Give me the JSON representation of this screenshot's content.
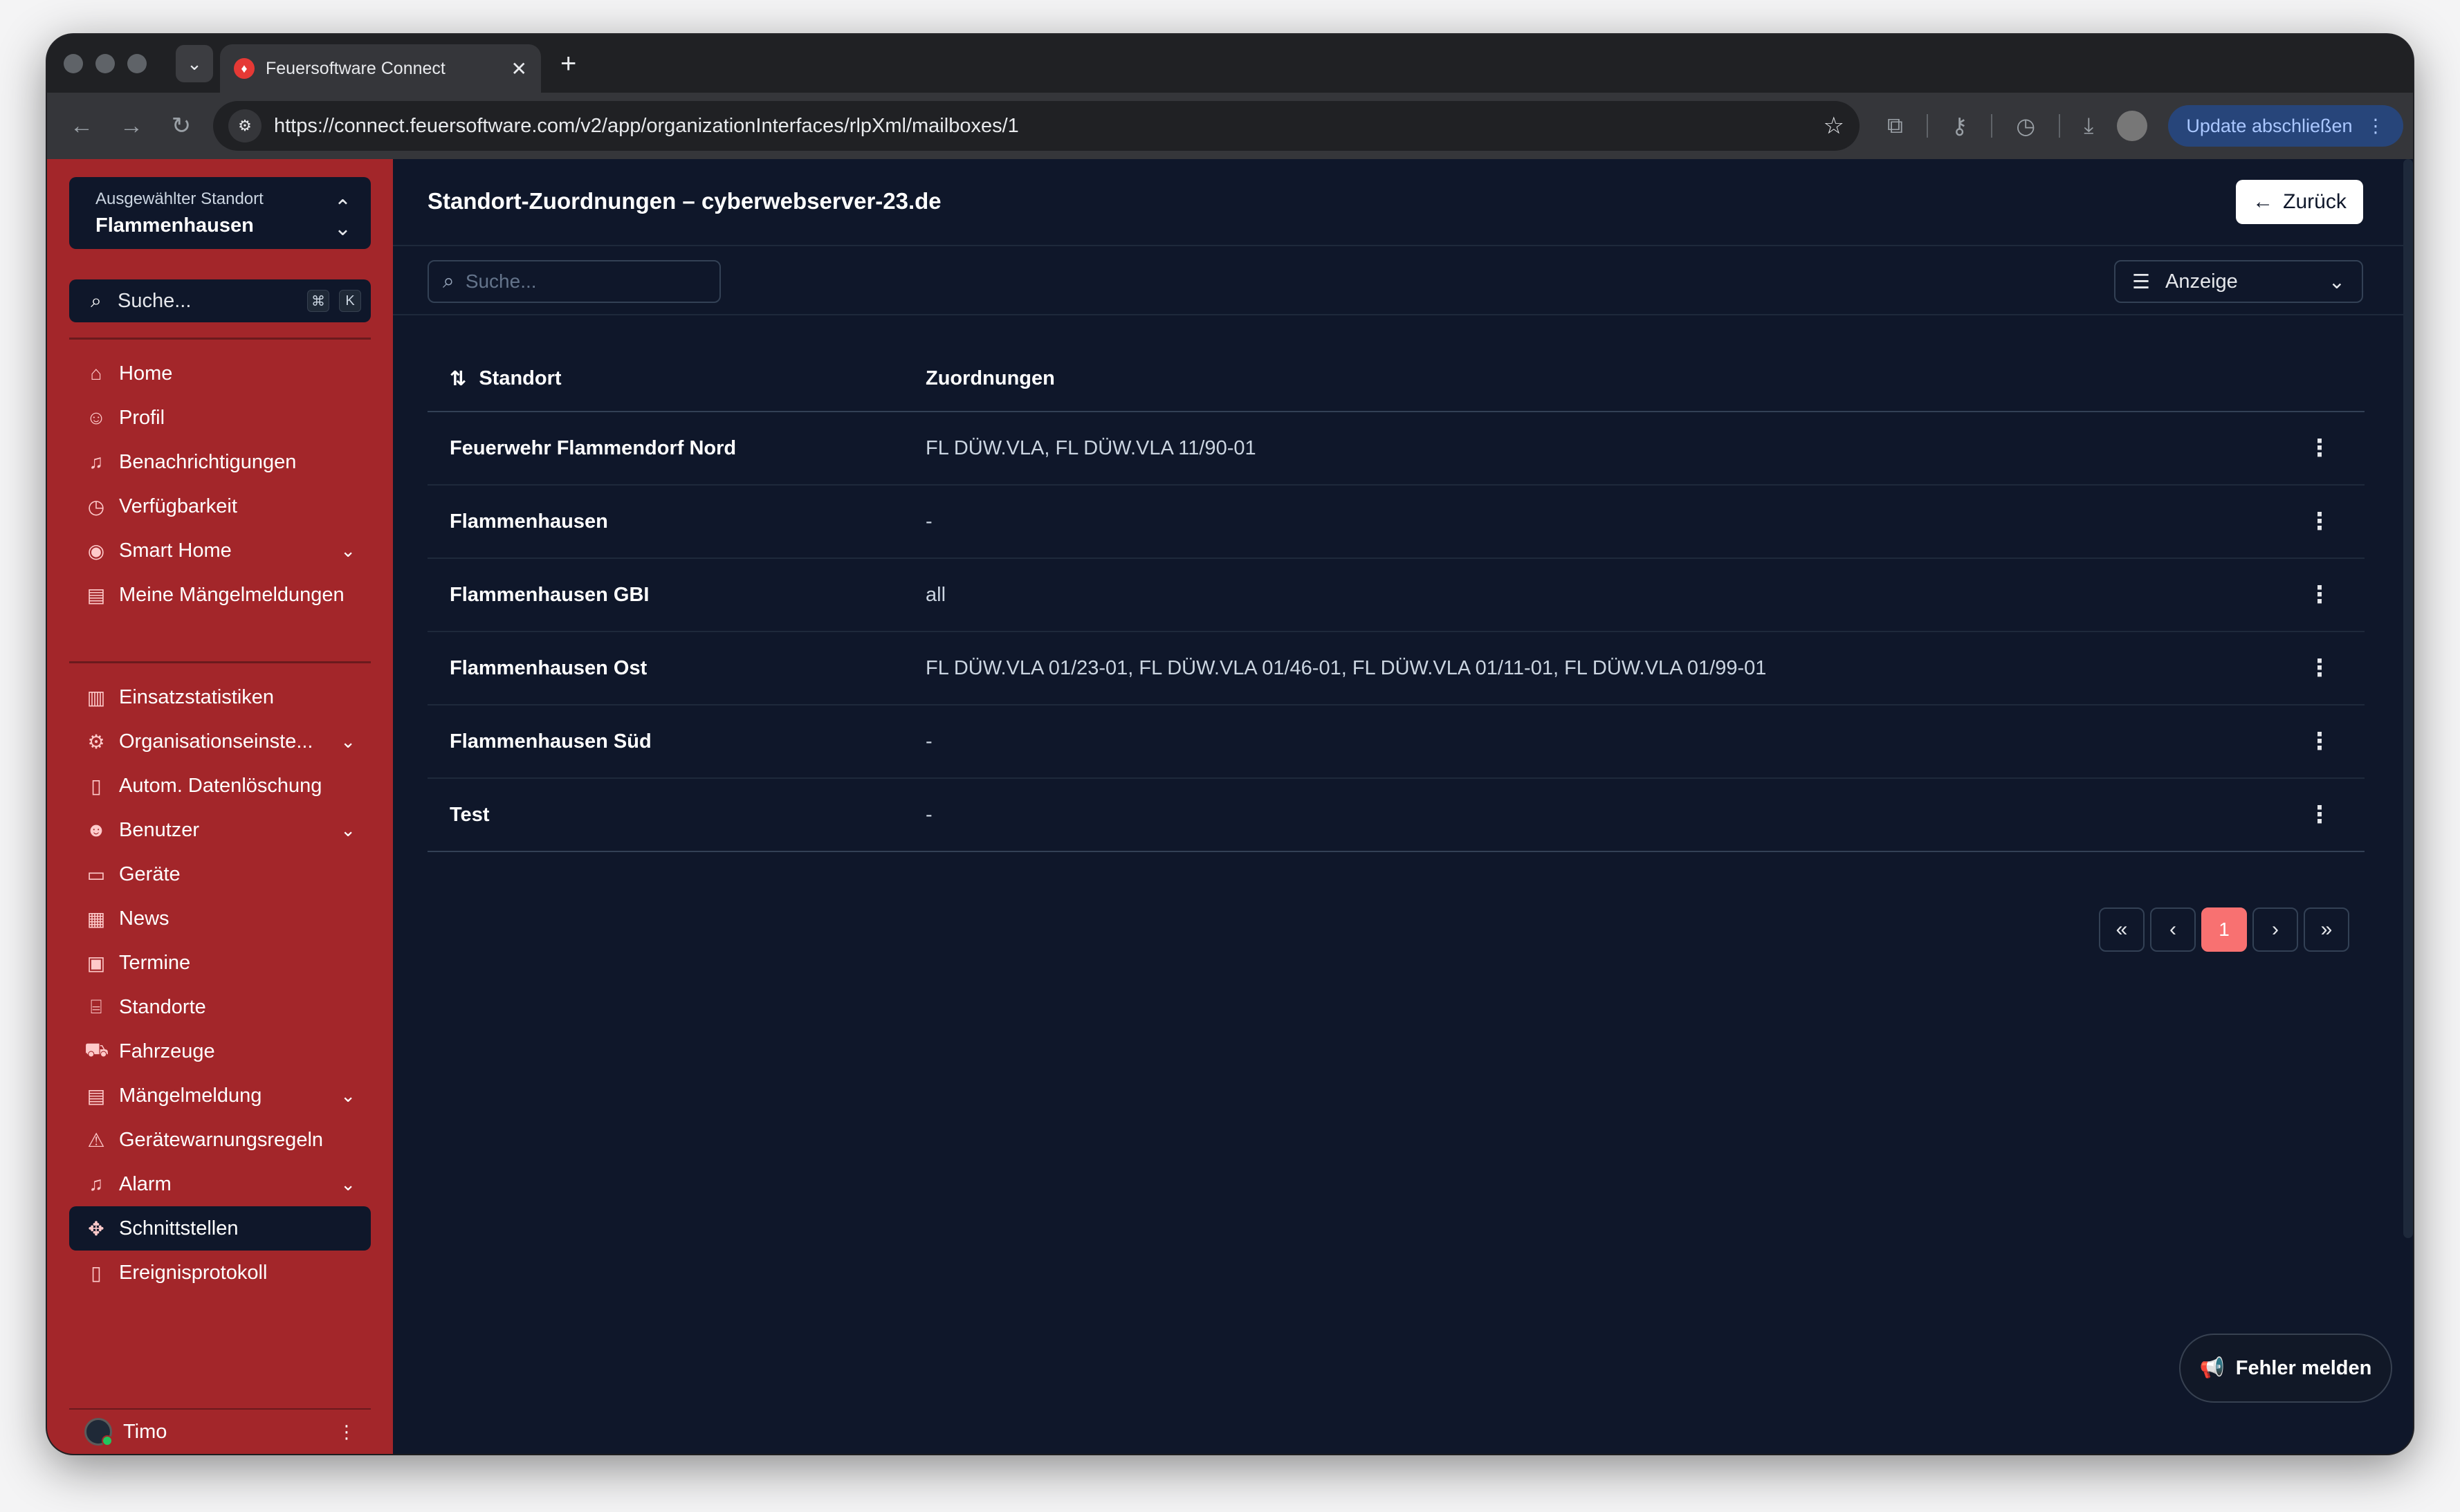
{
  "browser": {
    "tab_title": "Feuersoftware Connect",
    "url": "https://connect.feuersoftware.com/v2/app/organizationInterfaces/rlpXml/mailboxes/1",
    "update_label": "Update abschließen"
  },
  "sidebar": {
    "location_label": "Ausgewählter Standort",
    "location_value": "Flammenhausen",
    "search_label": "Suche...",
    "shortcut_cmd": "⌘",
    "shortcut_key": "K",
    "items_top": [
      {
        "label": "Home",
        "icon": "home-icon"
      },
      {
        "label": "Profil",
        "icon": "user-icon"
      },
      {
        "label": "Benachrichtigungen",
        "icon": "bell-icon"
      },
      {
        "label": "Verfügbarkeit",
        "icon": "clock-icon"
      },
      {
        "label": "Smart Home",
        "icon": "user-circle-icon"
      },
      {
        "label": "Meine Mängelmeldungen",
        "icon": "clipboard-icon"
      }
    ],
    "items_admin": [
      {
        "label": "Einsatzstatistiken",
        "icon": "chart-icon"
      },
      {
        "label": "Organisationseinste...",
        "icon": "gear-icon"
      },
      {
        "label": "Autom. Datenlöschung",
        "icon": "trash-icon"
      },
      {
        "label": "Benutzer",
        "icon": "users-icon"
      },
      {
        "label": "Geräte",
        "icon": "monitor-icon"
      },
      {
        "label": "News",
        "icon": "newspaper-icon"
      },
      {
        "label": "Termine",
        "icon": "calendar-icon"
      },
      {
        "label": "Standorte",
        "icon": "building-icon"
      },
      {
        "label": "Fahrzeuge",
        "icon": "truck-icon"
      },
      {
        "label": "Mängelmeldung",
        "icon": "clipboard-icon"
      },
      {
        "label": "Gerätewarnungsregeln",
        "icon": "warning-icon"
      },
      {
        "label": "Alarm",
        "icon": "bell-icon"
      },
      {
        "label": "Schnittstellen",
        "icon": "puzzle-icon"
      },
      {
        "label": "Ereignisprotokoll",
        "icon": "document-icon"
      }
    ],
    "user_name": "Timo"
  },
  "main": {
    "title": "Standort-Zuordnungen – cyberwebserver-23.de",
    "back_label": "Zurück",
    "search_placeholder": "Suche...",
    "view_label": "Anzeige",
    "columns": {
      "standort": "Standort",
      "zuordnungen": "Zuordnungen"
    },
    "rows": [
      {
        "name": "Feuerwehr Flammendorf Nord",
        "zuordnungen": "FL DÜW.VLA, FL DÜW.VLA 11/90-01"
      },
      {
        "name": "Flammenhausen",
        "zuordnungen": "-"
      },
      {
        "name": "Flammenhausen GBI",
        "zuordnungen": "all"
      },
      {
        "name": "Flammenhausen Ost",
        "zuordnungen": "FL DÜW.VLA 01/23-01, FL DÜW.VLA 01/46-01, FL DÜW.VLA 01/11-01, FL DÜW.VLA 01/99-01"
      },
      {
        "name": "Flammenhausen Süd",
        "zuordnungen": "-"
      },
      {
        "name": "Test",
        "zuordnungen": "-"
      }
    ],
    "pagination": {
      "current": "1"
    },
    "report_label": "Fehler melden"
  }
}
